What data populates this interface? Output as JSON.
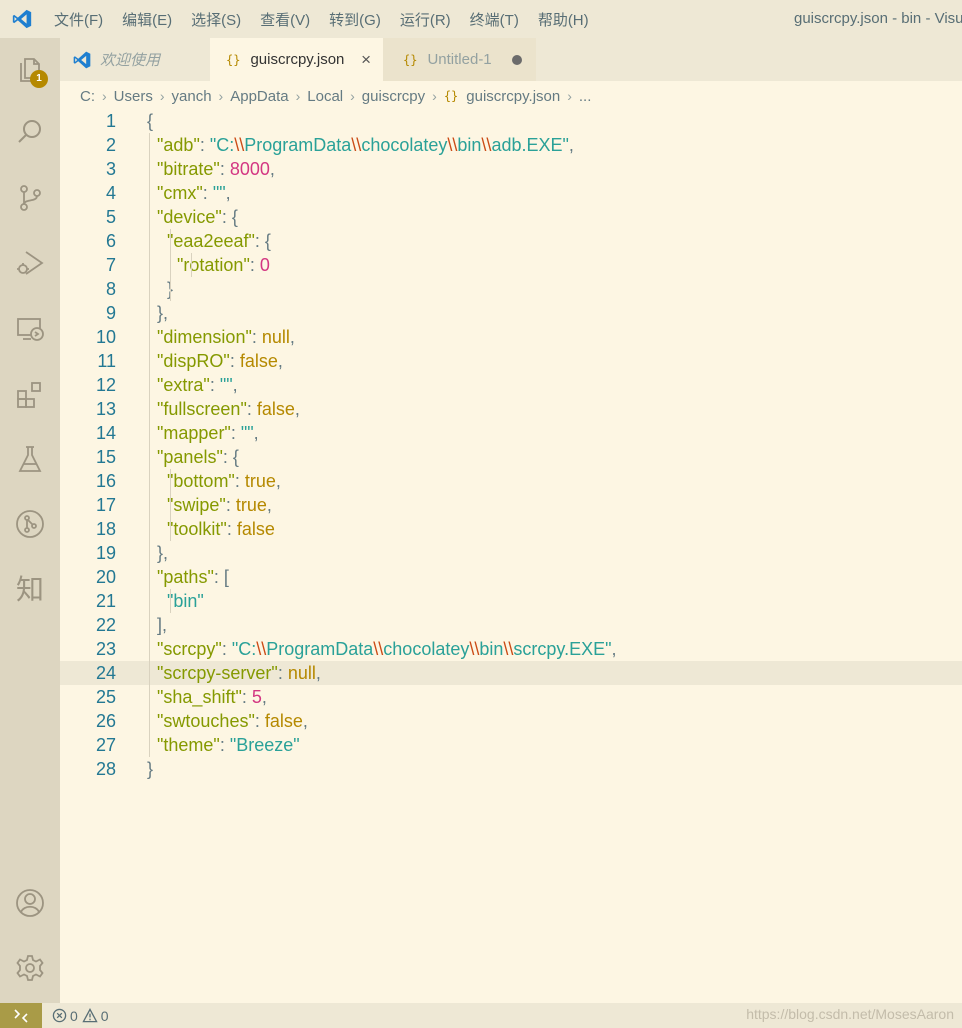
{
  "menu": [
    "文件(F)",
    "编辑(E)",
    "选择(S)",
    "查看(V)",
    "转到(G)",
    "运行(R)",
    "终端(T)",
    "帮助(H)"
  ],
  "window_title": "guiscrcpy.json - bin - Visual Studio Code",
  "activity": {
    "explorer_badge": "1",
    "zhi_label": "知"
  },
  "tabs": [
    {
      "label": "欢迎使用"
    },
    {
      "label": "guiscrcpy.json",
      "icon": "{}",
      "close": "×"
    },
    {
      "label": "Untitled-1",
      "icon": "{}"
    }
  ],
  "breadcrumb": [
    "C:",
    "Users",
    "yanch",
    "AppData",
    "Local",
    "guiscrcpy",
    "guiscrcpy.json",
    "..."
  ],
  "breadcrumb_icon": "{}",
  "editor": {
    "line_numbers": [
      "1",
      "2",
      "3",
      "4",
      "5",
      "6",
      "7",
      "8",
      "9",
      "10",
      "11",
      "12",
      "13",
      "14",
      "15",
      "16",
      "17",
      "18",
      "19",
      "20",
      "21",
      "22",
      "23",
      "24",
      "25",
      "26",
      "27",
      "28"
    ],
    "lines": [
      [
        [
          "p",
          "{"
        ]
      ],
      [
        [
          "p",
          "  "
        ],
        [
          "k",
          "\"adb\""
        ],
        [
          "p",
          ": "
        ],
        [
          "s",
          "\"C:"
        ],
        [
          "esc",
          "\\\\"
        ],
        [
          "s",
          "ProgramData"
        ],
        [
          "esc",
          "\\\\"
        ],
        [
          "s",
          "chocolatey"
        ],
        [
          "esc",
          "\\\\"
        ],
        [
          "s",
          "bin"
        ],
        [
          "esc",
          "\\\\"
        ],
        [
          "s",
          "adb.EXE\""
        ],
        [
          "p",
          ","
        ]
      ],
      [
        [
          "p",
          "  "
        ],
        [
          "k",
          "\"bitrate\""
        ],
        [
          "p",
          ": "
        ],
        [
          "n",
          "8000"
        ],
        [
          "p",
          ","
        ]
      ],
      [
        [
          "p",
          "  "
        ],
        [
          "k",
          "\"cmx\""
        ],
        [
          "p",
          ": "
        ],
        [
          "s",
          "\"\""
        ],
        [
          "p",
          ","
        ]
      ],
      [
        [
          "p",
          "  "
        ],
        [
          "k",
          "\"device\""
        ],
        [
          "p",
          ": {"
        ]
      ],
      [
        [
          "p",
          "    "
        ],
        [
          "k",
          "\"eaa2eeaf\""
        ],
        [
          "p",
          ": {"
        ]
      ],
      [
        [
          "p",
          "      "
        ],
        [
          "k",
          "\"rotation\""
        ],
        [
          "p",
          ": "
        ],
        [
          "n",
          "0"
        ]
      ],
      [
        [
          "p",
          "    }"
        ]
      ],
      [
        [
          "p",
          "  },"
        ]
      ],
      [
        [
          "p",
          "  "
        ],
        [
          "k",
          "\"dimension\""
        ],
        [
          "p",
          ": "
        ],
        [
          "c",
          "null"
        ],
        [
          "p",
          ","
        ]
      ],
      [
        [
          "p",
          "  "
        ],
        [
          "k",
          "\"dispRO\""
        ],
        [
          "p",
          ": "
        ],
        [
          "c",
          "false"
        ],
        [
          "p",
          ","
        ]
      ],
      [
        [
          "p",
          "  "
        ],
        [
          "k",
          "\"extra\""
        ],
        [
          "p",
          ": "
        ],
        [
          "s",
          "\"\""
        ],
        [
          "p",
          ","
        ]
      ],
      [
        [
          "p",
          "  "
        ],
        [
          "k",
          "\"fullscreen\""
        ],
        [
          "p",
          ": "
        ],
        [
          "c",
          "false"
        ],
        [
          "p",
          ","
        ]
      ],
      [
        [
          "p",
          "  "
        ],
        [
          "k",
          "\"mapper\""
        ],
        [
          "p",
          ": "
        ],
        [
          "s",
          "\"\""
        ],
        [
          "p",
          ","
        ]
      ],
      [
        [
          "p",
          "  "
        ],
        [
          "k",
          "\"panels\""
        ],
        [
          "p",
          ": {"
        ]
      ],
      [
        [
          "p",
          "    "
        ],
        [
          "k",
          "\"bottom\""
        ],
        [
          "p",
          ": "
        ],
        [
          "c",
          "true"
        ],
        [
          "p",
          ","
        ]
      ],
      [
        [
          "p",
          "    "
        ],
        [
          "k",
          "\"swipe\""
        ],
        [
          "p",
          ": "
        ],
        [
          "c",
          "true"
        ],
        [
          "p",
          ","
        ]
      ],
      [
        [
          "p",
          "    "
        ],
        [
          "k",
          "\"toolkit\""
        ],
        [
          "p",
          ": "
        ],
        [
          "c",
          "false"
        ]
      ],
      [
        [
          "p",
          "  },"
        ]
      ],
      [
        [
          "p",
          "  "
        ],
        [
          "k",
          "\"paths\""
        ],
        [
          "p",
          ": ["
        ]
      ],
      [
        [
          "p",
          "    "
        ],
        [
          "s",
          "\"bin\""
        ]
      ],
      [
        [
          "p",
          "  ],"
        ]
      ],
      [
        [
          "p",
          "  "
        ],
        [
          "k",
          "\"scrcpy\""
        ],
        [
          "p",
          ": "
        ],
        [
          "s",
          "\"C:"
        ],
        [
          "esc",
          "\\\\"
        ],
        [
          "s",
          "ProgramData"
        ],
        [
          "esc",
          "\\\\"
        ],
        [
          "s",
          "chocolatey"
        ],
        [
          "esc",
          "\\\\"
        ],
        [
          "s",
          "bin"
        ],
        [
          "esc",
          "\\\\"
        ],
        [
          "s",
          "scrcpy.EXE\""
        ],
        [
          "p",
          ","
        ]
      ],
      [
        [
          "p",
          "  "
        ],
        [
          "k",
          "\"scrcpy-server\""
        ],
        [
          "p",
          ": "
        ],
        [
          "c",
          "null"
        ],
        [
          "p",
          ","
        ]
      ],
      [
        [
          "p",
          "  "
        ],
        [
          "k",
          "\"sha_shift\""
        ],
        [
          "p",
          ": "
        ],
        [
          "n",
          "5"
        ],
        [
          "p",
          ","
        ]
      ],
      [
        [
          "p",
          "  "
        ],
        [
          "k",
          "\"swtouches\""
        ],
        [
          "p",
          ": "
        ],
        [
          "c",
          "false"
        ],
        [
          "p",
          ","
        ]
      ],
      [
        [
          "p",
          "  "
        ],
        [
          "k",
          "\"theme\""
        ],
        [
          "p",
          ": "
        ],
        [
          "s",
          "\"Breeze\""
        ]
      ],
      [
        [
          "p",
          "}"
        ]
      ]
    ],
    "current_line": "24"
  },
  "status": {
    "errors": "0",
    "warnings": "0"
  },
  "watermark": "https://blog.csdn.net/MosesAaron",
  "colors": {
    "background": "#fdf6e3",
    "activitybar": "#ddd6c1",
    "titlebar": "#eee8d5",
    "accent": "#b58900",
    "key": "#859900",
    "string": "#2aa198",
    "number": "#d33682",
    "escape": "#cb4b16",
    "line_number": "#237893"
  }
}
